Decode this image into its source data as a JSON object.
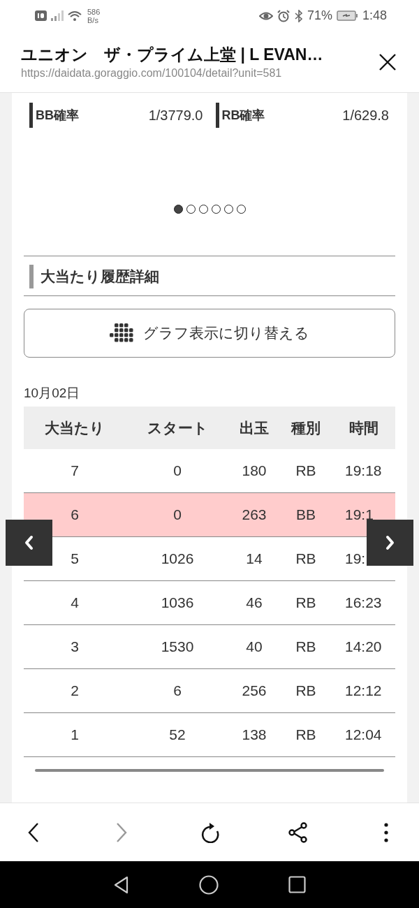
{
  "status_bar": {
    "network_speed": "586",
    "speed_unit": "B/s",
    "battery": "71%",
    "time": "1:48"
  },
  "browser_header": {
    "title": "ユニオン　ザ・プライム上堂 | L EVAN…",
    "url": "https://daidata.goraggio.com/100104/detail?unit=581"
  },
  "stats": [
    {
      "label": "BB確率",
      "value": "1/3779.0"
    },
    {
      "label": "RB確率",
      "value": "1/629.8"
    }
  ],
  "carousel_dots": [
    {
      "selected": true
    },
    {
      "selected": false
    },
    {
      "selected": false
    },
    {
      "selected": false
    },
    {
      "selected": false
    },
    {
      "selected": false
    }
  ],
  "section_title": "大当たり履歴詳細",
  "toggle_button": {
    "label": "グラフ表示に切り替える"
  },
  "date": "10月02日",
  "table": {
    "columns": [
      "大当たり",
      "スタート",
      "出玉",
      "種別",
      "時間"
    ],
    "rows": [
      {
        "cells": [
          "7",
          "0",
          "180",
          "RB",
          "19:18"
        ],
        "highlighted": false
      },
      {
        "cells": [
          "6",
          "0",
          "263",
          "BB",
          "19:1"
        ],
        "highlighted": true
      },
      {
        "cells": [
          "5",
          "1026",
          "14",
          "RB",
          "19:"
        ],
        "highlighted": false
      },
      {
        "cells": [
          "4",
          "1036",
          "46",
          "RB",
          "16:23"
        ],
        "highlighted": false
      },
      {
        "cells": [
          "3",
          "1530",
          "40",
          "RB",
          "14:20"
        ],
        "highlighted": false
      },
      {
        "cells": [
          "2",
          "6",
          "256",
          "RB",
          "12:12"
        ],
        "highlighted": false
      },
      {
        "cells": [
          "1",
          "52",
          "138",
          "RB",
          "12:04"
        ],
        "highlighted": false
      }
    ]
  },
  "toolbar": [
    {
      "kind": "back",
      "disabled": false
    },
    {
      "kind": "forward",
      "disabled": true
    },
    {
      "kind": "reload",
      "disabled": false
    },
    {
      "kind": "share",
      "disabled": false
    },
    {
      "kind": "menu",
      "disabled": false
    }
  ]
}
